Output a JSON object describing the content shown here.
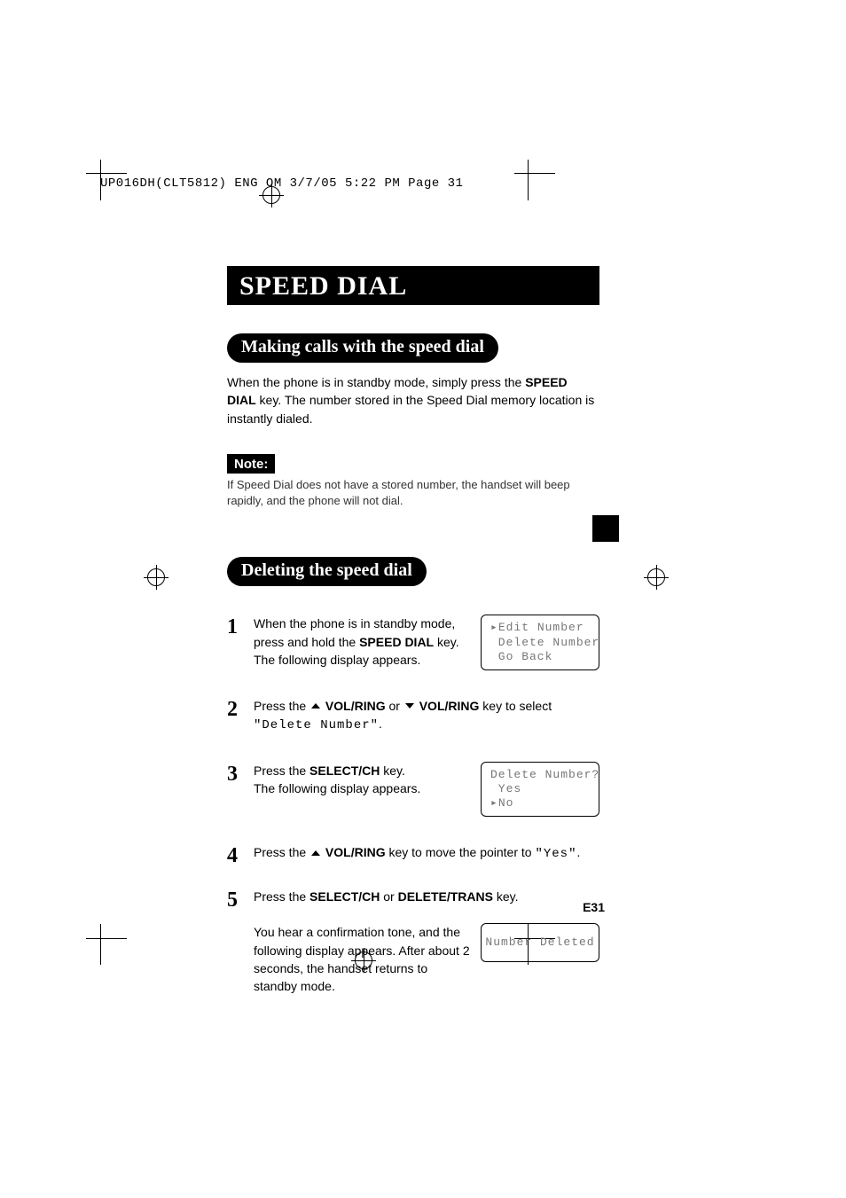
{
  "header": "UP016DH(CLT5812) ENG OM  3/7/05  5:22 PM  Page 31",
  "title": "SPEED DIAL",
  "section1": {
    "heading": "Making calls with the speed dial",
    "body_pre": "When the phone is in standby mode, simply press the ",
    "body_bold": "SPEED DIAL",
    "body_post": " key. The number stored in the Speed Dial memory location is instantly dialed."
  },
  "note": {
    "label": "Note:",
    "text": "If Speed Dial does not have a stored number, the handset will beep rapidly, and the phone will not dial."
  },
  "section2": {
    "heading": "Deleting the speed dial",
    "step1": {
      "num": "1",
      "l1": "When the phone is in standby mode, press and hold the ",
      "b1": "SPEED DIAL",
      "l2": " key. The following display appears.",
      "lcd": "▸Edit Number\n Delete Number\n Go Back"
    },
    "step2": {
      "num": "2",
      "l1": "Press the ",
      "b1": "VOL/RING",
      "l2": " or ",
      "b2": "VOL/RING",
      "l3": " key to select ",
      "mono": "\"Delete Number\"",
      "l4": "."
    },
    "step3": {
      "num": "3",
      "l1": "Press the ",
      "b1": "SELECT/CH",
      "l2": " key.",
      "l3": "The following display appears.",
      "lcd": "Delete Number?\n Yes\n▸No"
    },
    "step4": {
      "num": "4",
      "l1": "Press the ",
      "b1": "VOL/RING",
      "l2": " key to move the pointer to ",
      "mono": "\"Yes\"",
      "l3": "."
    },
    "step5": {
      "num": "5",
      "l1": "Press the ",
      "b1": "SELECT/CH",
      "l2": " or ",
      "b2": "DELETE/TRANS",
      "l3": " key.",
      "p2": "You hear a confirmation tone, and the following display appears. After about 2 seconds, the handset returns to standby mode.",
      "lcd": "Number Deleted"
    }
  },
  "page_num": "E31"
}
